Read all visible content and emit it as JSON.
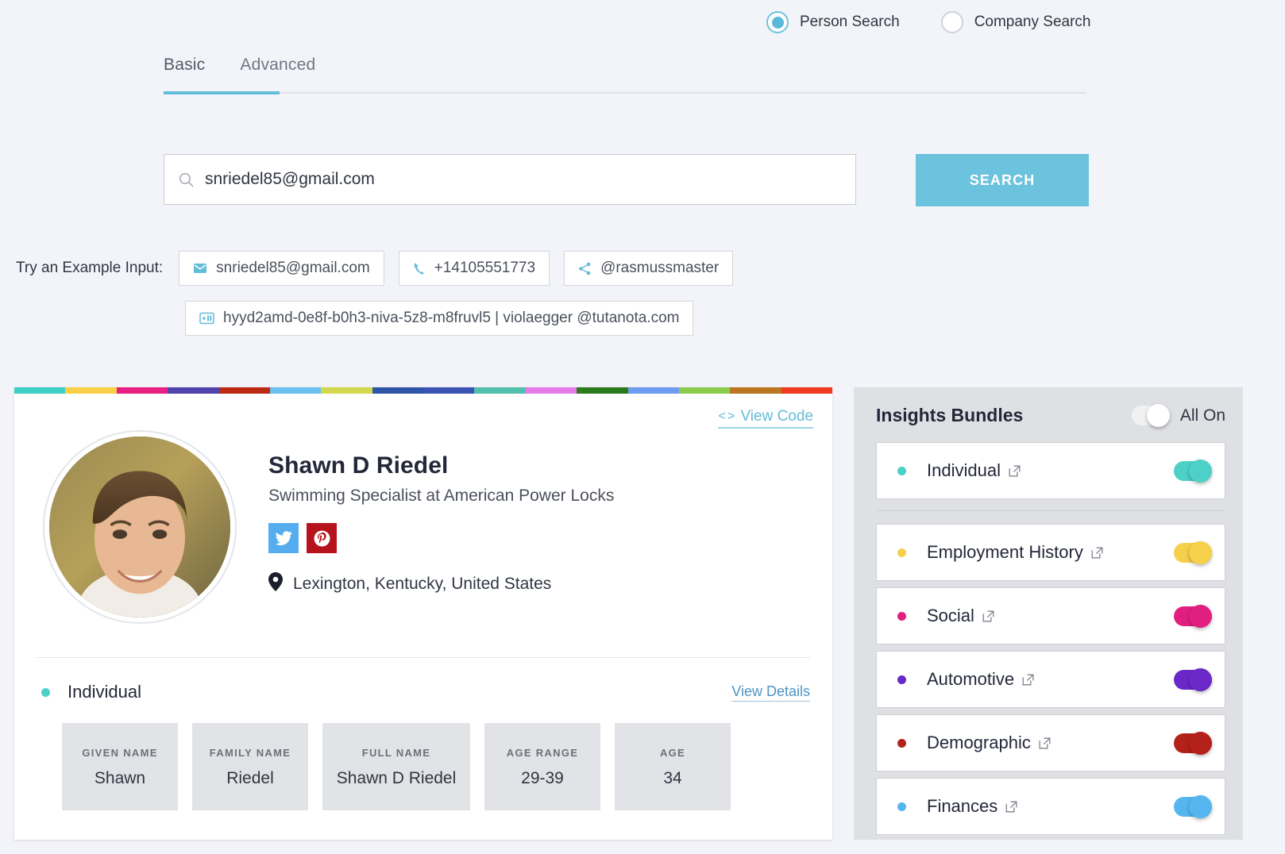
{
  "search_modes": [
    {
      "label": "Person Search",
      "selected": true,
      "name": "person-search"
    },
    {
      "label": "Company Search",
      "selected": false,
      "name": "company-search"
    }
  ],
  "tabs": [
    {
      "label": "Basic",
      "active": true
    },
    {
      "label": "Advanced",
      "active": false
    }
  ],
  "search": {
    "value": "snriedel85@gmail.com",
    "placeholder": "snriedel85@gmail.com",
    "button_label": "SEARCH",
    "icon": "search-icon"
  },
  "examples": {
    "label": "Try an Example Input:",
    "chips": [
      {
        "text": "snriedel85@gmail.com",
        "icon": "envelope-icon"
      },
      {
        "text": "+14105551773",
        "icon": "phone-icon"
      },
      {
        "text": "@rasmussmaster",
        "icon": "share-icon"
      },
      {
        "text": "hyyd2amd-0e8f-b0h3-niva-5z8-m8fruvl5 | violaegger @tutanota.com",
        "icon": "device-id-icon"
      }
    ]
  },
  "card": {
    "stripe_colors": [
      "#3ed0c4",
      "#f9d048",
      "#e81f82",
      "#5144ad",
      "#bd2a13",
      "#6cc0ef",
      "#d3d84f",
      "#2f55a8",
      "#3b54b4",
      "#52bfae",
      "#e57ce8",
      "#2b7a1c",
      "#6e9cf0",
      "#8bcc4d",
      "#b9761f",
      "#ee3b21"
    ],
    "view_code_label": "View Code",
    "view_code_icon": "code-brackets-icon",
    "name": "Shawn D Riedel",
    "title": "Swimming Specialist at American Power Locks",
    "location": "Lexington, Kentucky, United States",
    "location_icon": "map-pin-icon",
    "socials": [
      {
        "network": "twitter",
        "color": "#55acee"
      },
      {
        "network": "pinterest",
        "color": "#b5121b"
      }
    ],
    "section": {
      "title": "Individual",
      "dot_color": "#4dd0c8",
      "view_details_label": "View Details"
    },
    "fields": [
      {
        "label": "GIVEN NAME",
        "value": "Shawn"
      },
      {
        "label": "FAMILY NAME",
        "value": "Riedel"
      },
      {
        "label": "FULL NAME",
        "value": "Shawn D Riedel"
      },
      {
        "label": "AGE RANGE",
        "value": "29-39"
      },
      {
        "label": "AGE",
        "value": "34"
      }
    ]
  },
  "insights": {
    "title": "Insights Bundles",
    "all_on_label": "All On",
    "all_on_state": false,
    "bundles": [
      {
        "label": "Individual",
        "color": "#4dd0c8",
        "on": true,
        "icon": "external-link-icon"
      },
      {
        "label": "Employment History",
        "color": "#f6cf4b",
        "on": true,
        "icon": "external-link-icon"
      },
      {
        "label": "Social",
        "color": "#e01f81",
        "on": true,
        "icon": "external-link-icon"
      },
      {
        "label": "Automotive",
        "color": "#6a28c9",
        "on": true,
        "icon": "external-link-icon"
      },
      {
        "label": "Demographic",
        "color": "#b4211b",
        "on": true,
        "icon": "external-link-icon"
      },
      {
        "label": "Finances",
        "color": "#55b6ef",
        "on": true,
        "icon": "external-link-icon"
      }
    ]
  }
}
